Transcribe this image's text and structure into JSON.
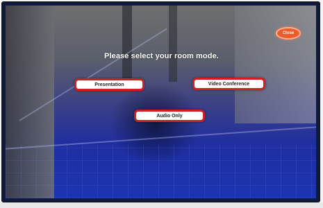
{
  "screen": {
    "prompt": "Please select your room mode.",
    "close_label": "Close"
  },
  "modes": [
    {
      "label": "Presentation"
    },
    {
      "label": "Video Conference"
    },
    {
      "label": "Audio Only"
    }
  ],
  "colors": {
    "button_border": "#d21f1f",
    "close_button": "#ee5b2a",
    "screen_blue": "#1d34b2"
  }
}
